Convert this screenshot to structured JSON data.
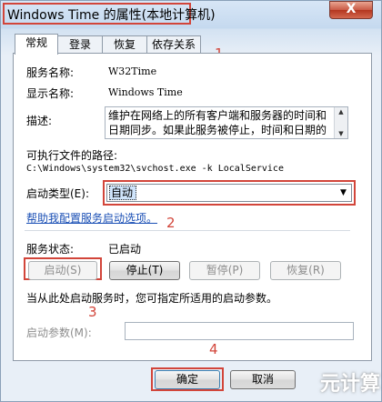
{
  "window": {
    "title": "Windows Time 的属性(本地计算机)",
    "close_glyph": "X"
  },
  "tabs": [
    {
      "label": "常规",
      "active": true
    },
    {
      "label": "登录",
      "active": false
    },
    {
      "label": "恢复",
      "active": false
    },
    {
      "label": "依存关系",
      "active": false
    }
  ],
  "general": {
    "service_name_label": "服务名称:",
    "service_name_value": "W32Time",
    "display_name_label": "显示名称:",
    "display_name_value": "Windows Time",
    "description_label": "描述:",
    "description_value": "维护在网络上的所有客户端和服务器的时间和日期同步。如果此服务被停止，时间和日期的",
    "exec_path_label": "可执行文件的路径:",
    "exec_path_value": "C:\\Windows\\system32\\svchost.exe -k LocalService",
    "startup_type_label": "启动类型(E):",
    "startup_type_value": "自动",
    "help_link": "帮助我配置服务启动选项。",
    "status_label": "服务状态:",
    "status_value": "已启动",
    "buttons": {
      "start": "启动(S)",
      "stop": "停止(T)",
      "pause": "暂停(P)",
      "resume": "恢复(R)"
    },
    "hint": "当从此处启动服务时，您可指定所适用的启动参数。",
    "start_params_label": "启动参数(M):",
    "start_params_value": ""
  },
  "footer": {
    "ok": "确定",
    "cancel": "取消"
  },
  "annotations": [
    "1",
    "2",
    "3",
    "4"
  ],
  "watermark": "元计算",
  "colors": {
    "highlight": "#d2453a",
    "link": "#1a4fb5"
  }
}
